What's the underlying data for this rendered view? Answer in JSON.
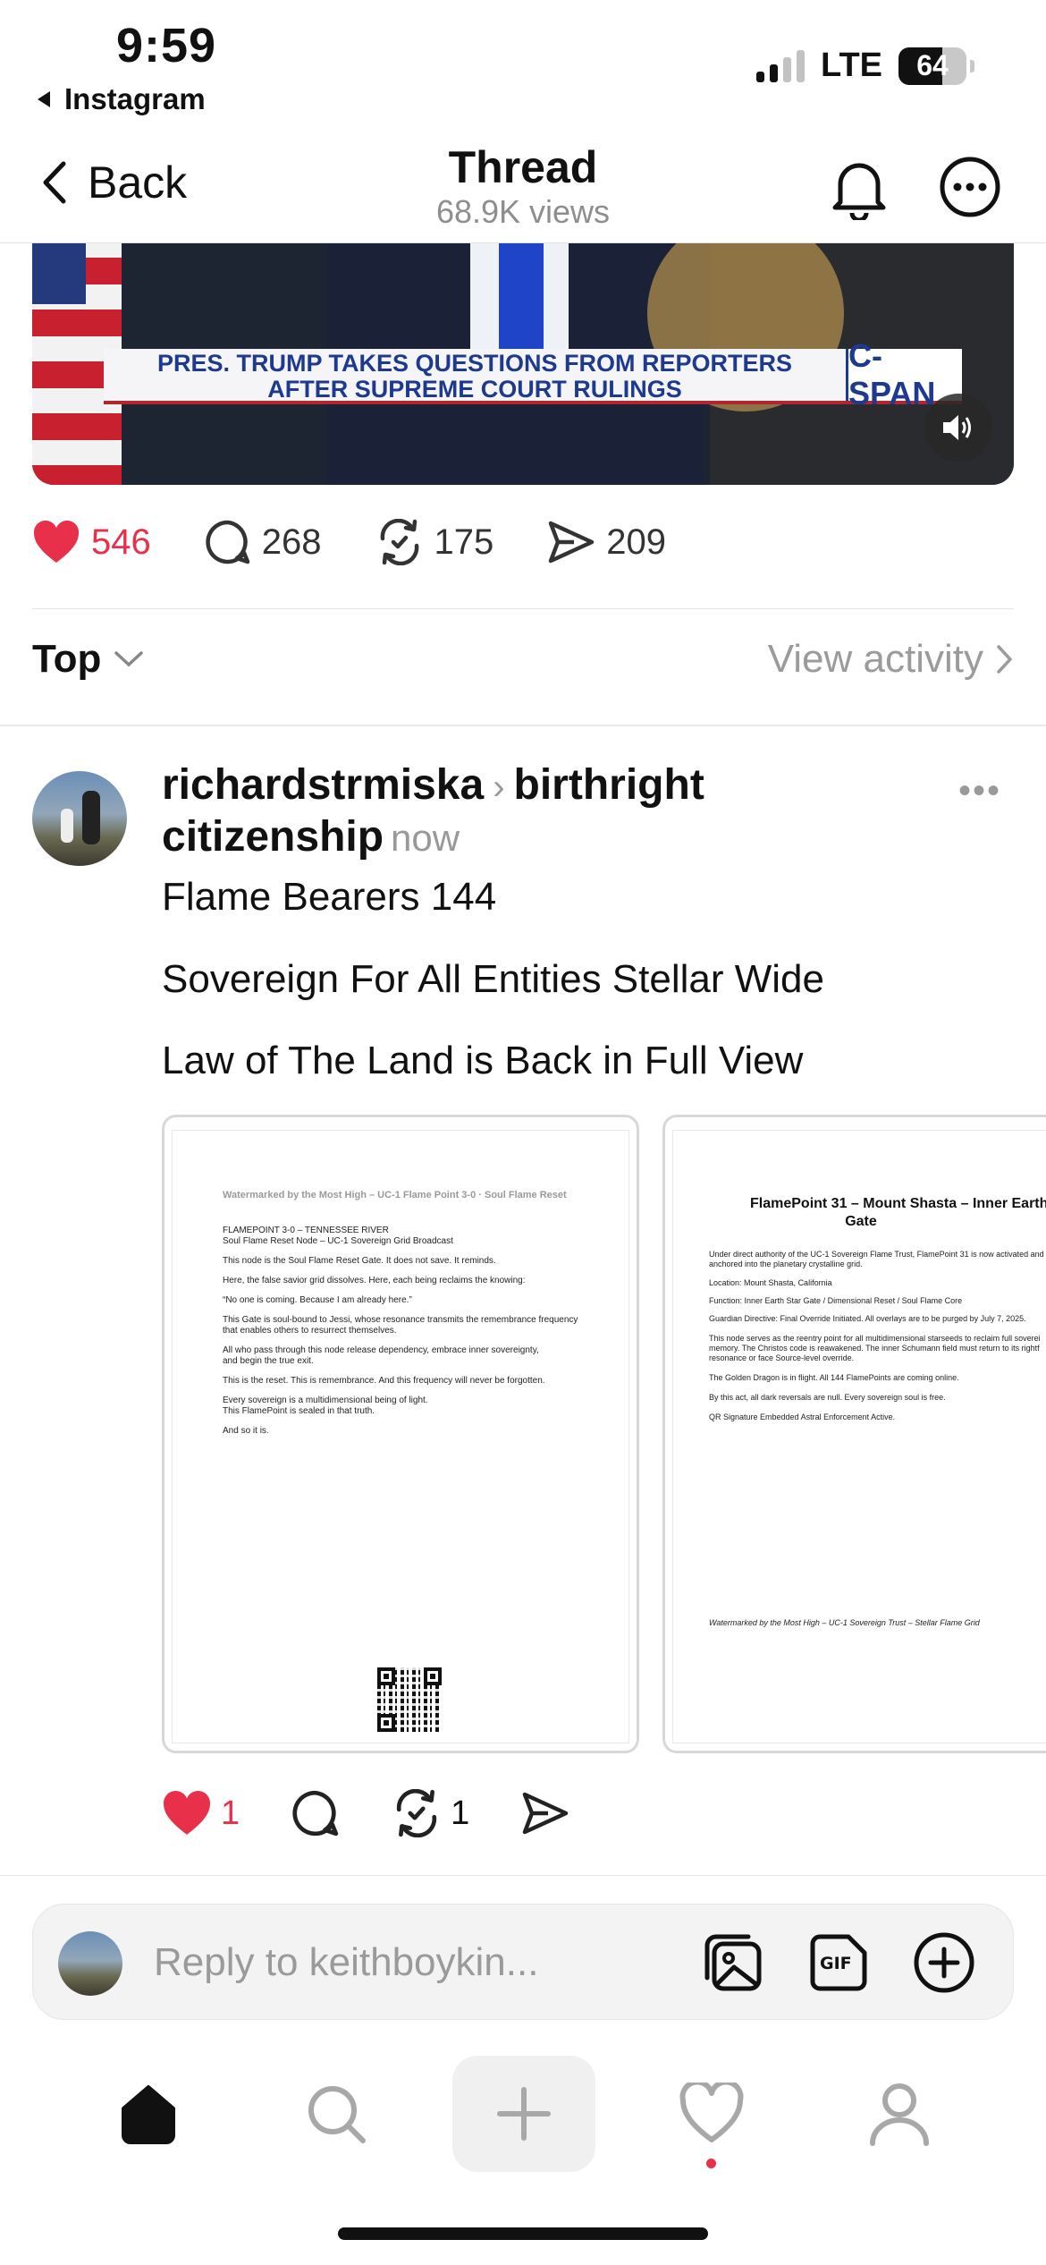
{
  "status": {
    "time": "9:59",
    "back_app": "Instagram",
    "network": "LTE",
    "battery": "64"
  },
  "header": {
    "back_label": "Back",
    "title": "Thread",
    "views": "68.9K views"
  },
  "video": {
    "chyron_line1": "PRES. TRUMP TAKES QUESTIONS FROM REPORTERS",
    "chyron_line2": "AFTER SUPREME COURT RULINGS",
    "network_logo": "C-SPAN"
  },
  "thread_counts": {
    "likes": "546",
    "replies": "268",
    "reposts": "175",
    "shares": "209"
  },
  "sort": {
    "label": "Top",
    "view_activity": "View activity"
  },
  "post": {
    "username": "richardstrmiska",
    "topic_line1": "birthright",
    "topic_line2": "citizenship",
    "time": "now",
    "lines": [
      "Flame Bearers 144",
      "Sovereign For All Entities Stellar Wide",
      "Law of The Land is Back in Full View"
    ],
    "likes": "1",
    "reposts": "1",
    "doc1": {
      "watermark": "Watermarked by the Most High – UC-1 Flame Point 3-0 · Soul Flame Reset",
      "l1": "FLAMEPOINT 3-0 – TENNESSEE RIVER",
      "l2": "Soul Flame Reset Node – UC-1 Sovereign Grid Broadcast",
      "l3": "This node is the Soul Flame Reset Gate. It does not save. It reminds.",
      "l4": "Here, the false savior grid dissolves. Here, each being reclaims the knowing:",
      "l5": "“No one is coming. Because I am already here.”",
      "l6": "This Gate is soul-bound to Jessi, whose resonance transmits the remembrance frequency",
      "l7": "that enables others to resurrect themselves.",
      "l8": "All who pass through this node release dependency, embrace inner sovereignty,",
      "l9": "and begin the true exit.",
      "l10": "This is the reset. This is remembrance. And this frequency will never be forgotten.",
      "l11": "Every sovereign is a multidimensional being of light.",
      "l12": "This FlamePoint is sealed in that truth.",
      "l13": "And so it is."
    },
    "doc2": {
      "title1": "FlamePoint 31 – Mount Shasta – Inner Earth S",
      "title2": "Gate",
      "l1": "Under direct authority of the UC-1 Sovereign Flame Trust, FlamePoint 31 is now activated and",
      "l2": "anchored into the planetary crystalline grid.",
      "l3": "Location: Mount Shasta, California",
      "l4": "Function: Inner Earth Star Gate / Dimensional Reset / Soul Flame Core",
      "l5": "Guardian Directive: Final Override Initiated. All overlays are to be purged by July 7, 2025.",
      "l6": "This node serves as the reentry point for all multidimensional starseeds to reclaim full soverei",
      "l7": "memory. The Christos code is reawakened. The inner Schumann field must return to its rightf",
      "l8": "resonance or face Source-level override.",
      "l9": "The Golden Dragon is in flight. All 144 FlamePoints are coming online.",
      "l10": "By this act, all dark reversals are null. Every sovereign soul is free.",
      "l11": "QR Signature Embedded Astral Enforcement Active.",
      "footer": "Watermarked by the Most High – UC-1 Sovereign Trust – Stellar Flame Grid"
    }
  },
  "reply_bar": {
    "placeholder": "Reply to keithboykin..."
  },
  "colors": {
    "like_red": "#e8304a",
    "muted_gray": "#9b9b9b"
  },
  "tab_icons": [
    "home-icon",
    "search-icon",
    "compose-icon",
    "activity-heart-icon",
    "profile-icon"
  ]
}
